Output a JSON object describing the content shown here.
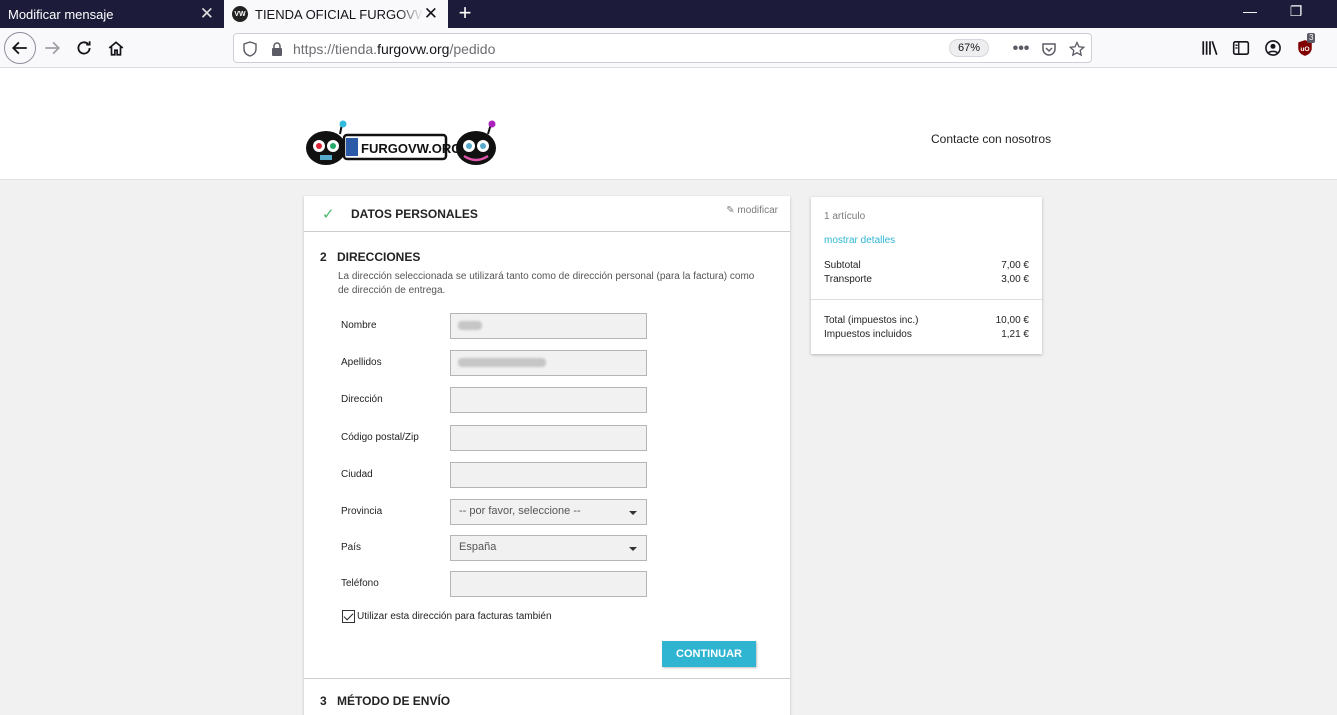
{
  "browser": {
    "tabs": [
      {
        "label": "Modificar mensaje"
      },
      {
        "label": "TIENDA OFICIAL FURGOVW.ORG"
      }
    ],
    "url": {
      "scheme": "https://tienda.",
      "domain": "furgovw.org",
      "path": "/pedido"
    },
    "zoom": "67%",
    "extension_badge": "3"
  },
  "site": {
    "logo_text": "FURGOVW.ORG",
    "contact": "Contacte con nosotros"
  },
  "checkout": {
    "step1": {
      "title": "DATOS PERSONALES",
      "edit_label": "modificar"
    },
    "step2": {
      "number": "2",
      "title": "DIRECCIONES",
      "description": "La dirección seleccionada se utilizará tanto como de dirección personal (para la factura) como de dirección de entrega.",
      "fields": [
        {
          "label": "Nombre",
          "value": ""
        },
        {
          "label": "Apellidos",
          "value": ""
        },
        {
          "label": "Dirección",
          "value": ""
        },
        {
          "label": "Código postal/Zip",
          "value": ""
        },
        {
          "label": "Ciudad",
          "value": ""
        },
        {
          "label": "Provincia",
          "value": "-- por favor, seleccione --"
        },
        {
          "label": "País",
          "value": "España"
        },
        {
          "label": "Teléfono",
          "value": ""
        }
      ],
      "checkbox_label": "Utilizar esta dirección para facturas también",
      "checkbox_checked": true,
      "continue_label": "CONTINUAR"
    },
    "step3": {
      "number": "3",
      "title": "MÉTODO DE ENVÍO"
    }
  },
  "summary": {
    "items": "1 artículo",
    "details_link": "mostrar detalles",
    "subtotal_label": "Subtotal",
    "subtotal": "7,00 €",
    "shipping_label": "Transporte",
    "shipping": "3,00 €",
    "total_label": "Total (impuestos inc.)",
    "total": "10,00 €",
    "tax_label": "Impuestos incluidos",
    "tax": "1,21 €"
  },
  "colors": {
    "accent": "#2fb5d2",
    "check": "#4cbb6c",
    "tabbar": "#1c1b3a"
  }
}
